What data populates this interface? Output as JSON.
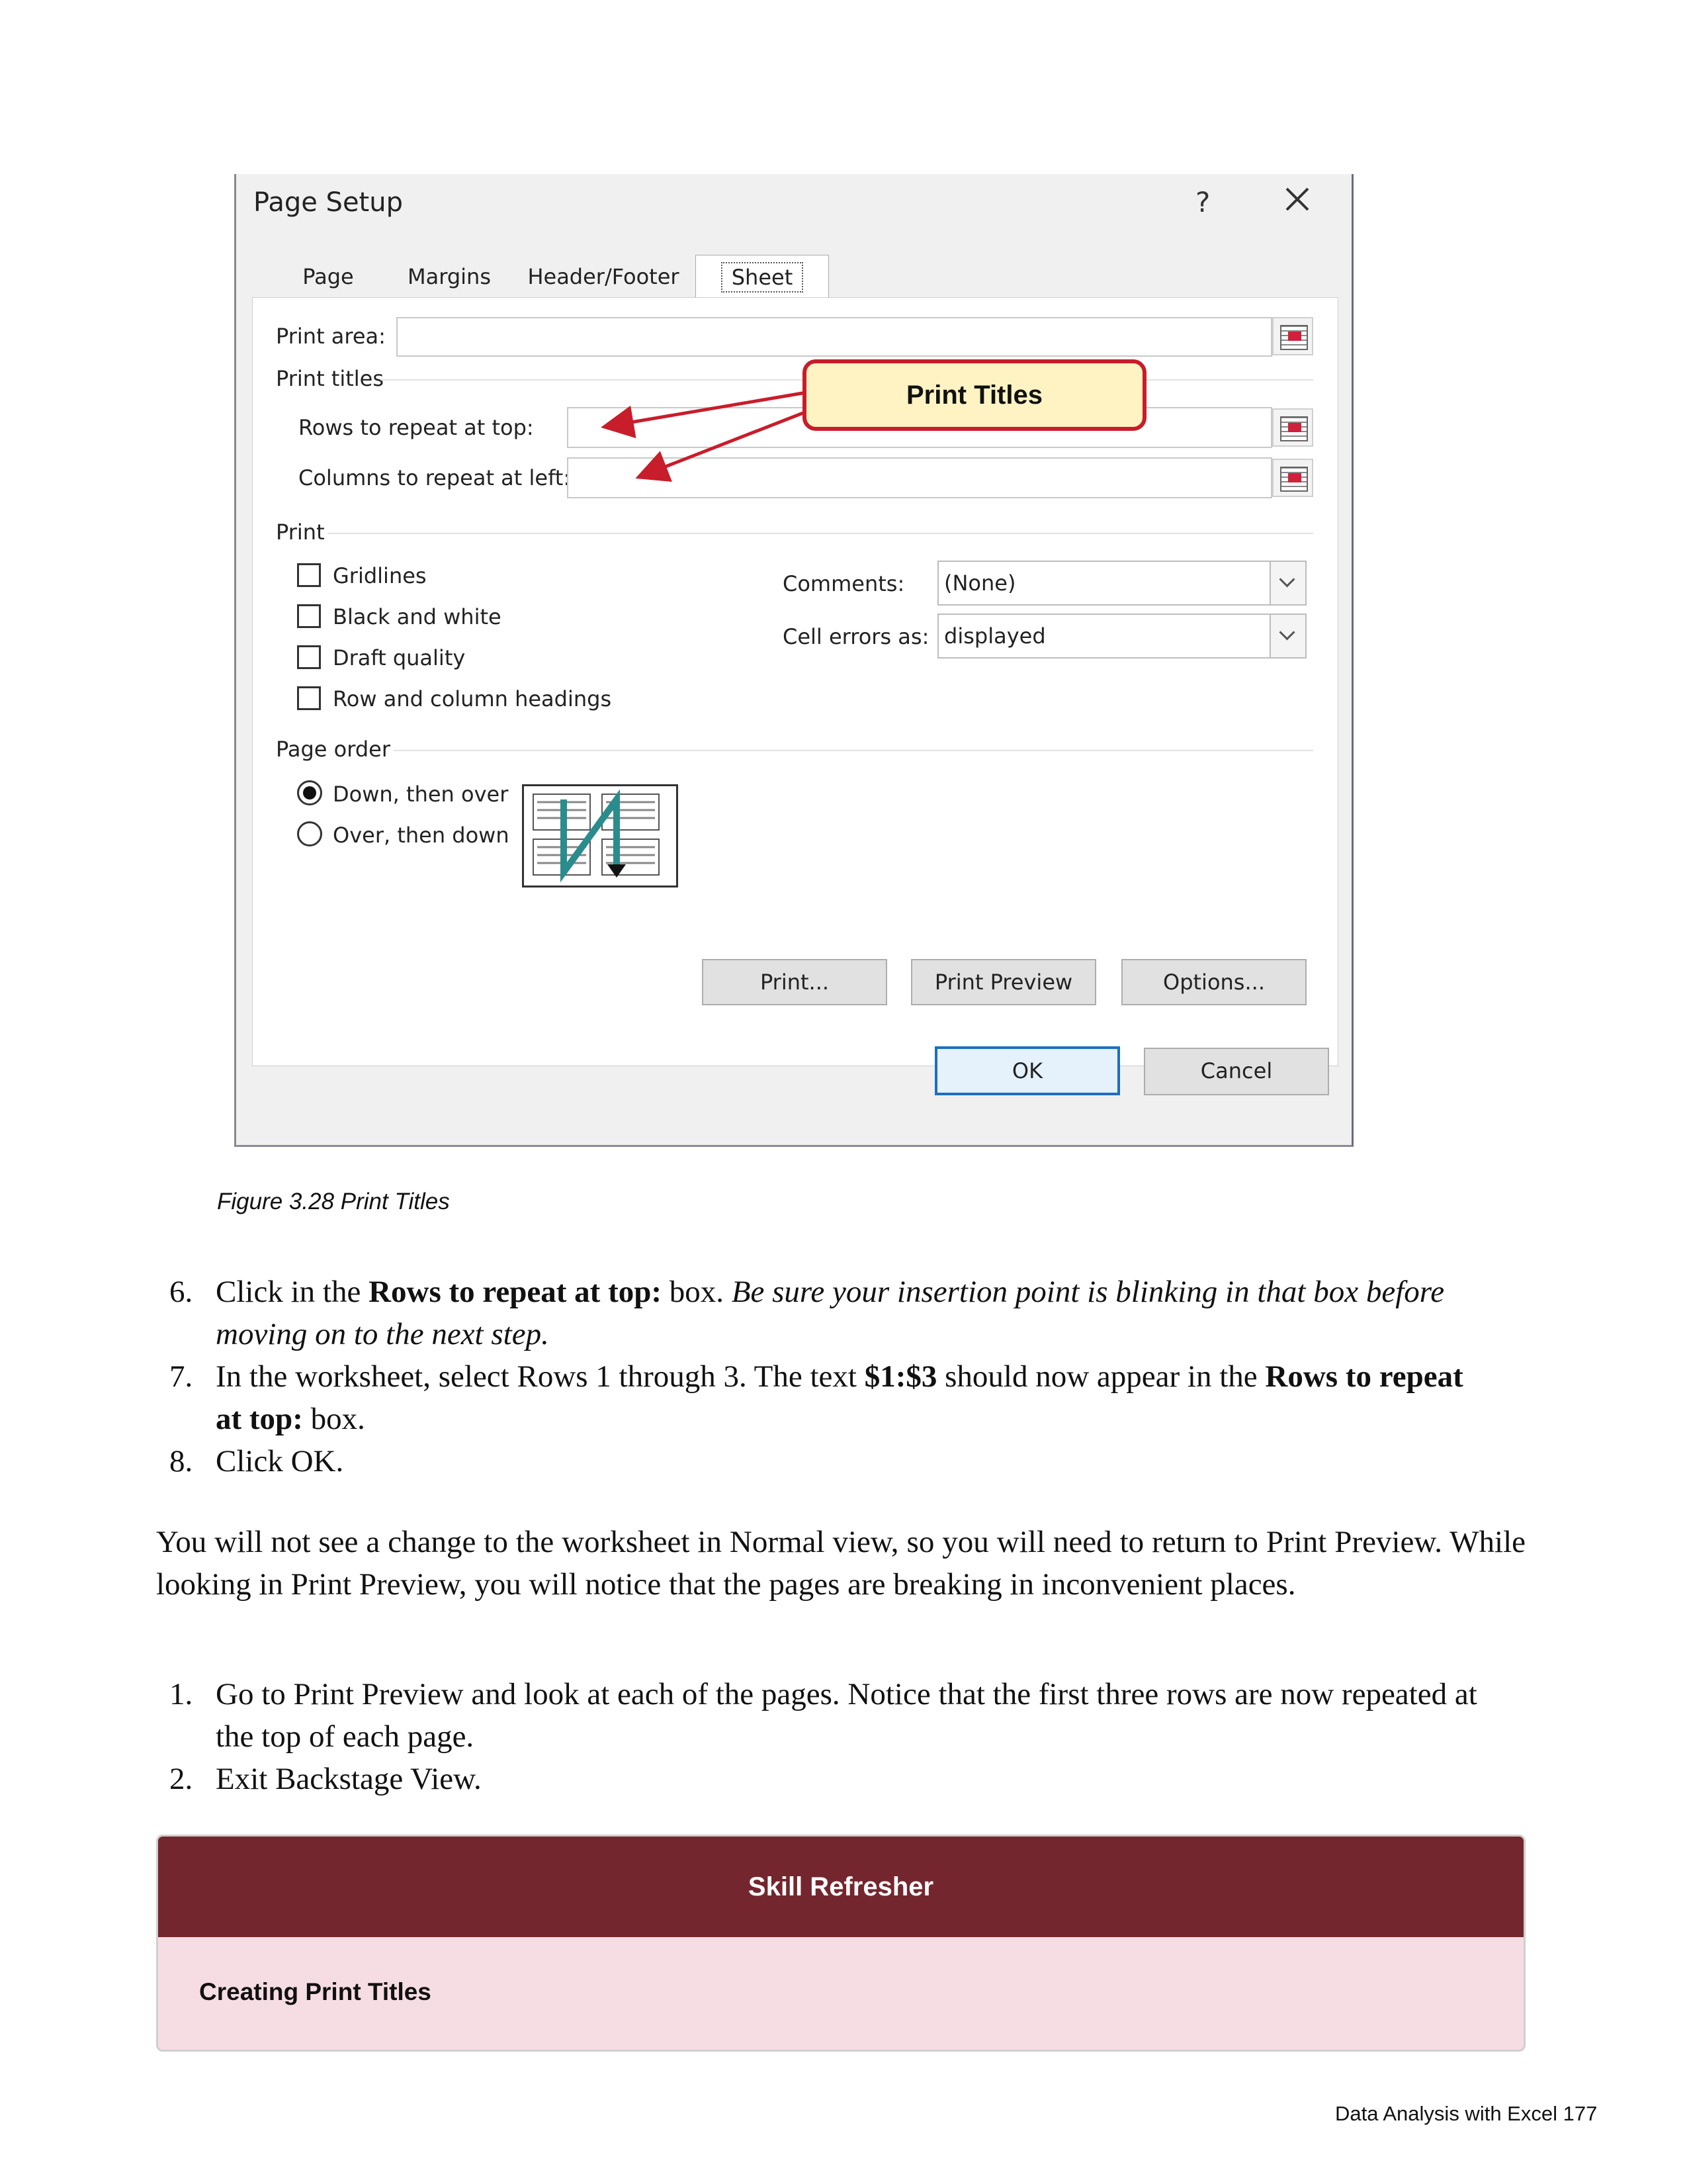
{
  "dialog": {
    "title": "Page Setup",
    "help_glyph": "?",
    "tabs": [
      "Page",
      "Margins",
      "Header/Footer",
      "Sheet"
    ],
    "print_area_label": "Print area:",
    "print_titles_label": "Print titles",
    "rows_label": "Rows to repeat at top:",
    "cols_label": "Columns to repeat at left:",
    "print_group_label": "Print",
    "checkboxes": [
      "Gridlines",
      "Black and white",
      "Draft quality",
      "Row and column headings"
    ],
    "comments_label": "Comments:",
    "comments_value": "(None)",
    "errors_label": "Cell errors as:",
    "errors_value": "displayed",
    "page_order_label": "Page order",
    "radio_down": "Down, then over",
    "radio_over": "Over, then down",
    "print_btn": "Print...",
    "preview_btn": "Print Preview",
    "options_btn": "Options...",
    "ok_btn": "OK",
    "cancel_btn": "Cancel",
    "callout": "Print Titles"
  },
  "caption": "Figure 3.28 Print Titles",
  "steps_a": [
    {
      "num": "6.",
      "pre": "Click in the ",
      "bold": "Rows to repeat at top:",
      "post": " box. ",
      "italic": "Be sure your insertion point is blinking in that box before moving on to the next step."
    },
    {
      "num": "7.",
      "pre": "In the worksheet, select Rows 1 through 3. The text ",
      "bold": "$1:$3",
      "post": " should now appear in the ",
      "bold2": "Rows to repeat at top:",
      "post2": " box."
    },
    {
      "num": "8.",
      "text": "Click OK."
    }
  ],
  "paragraph": "You will not see a change to the worksheet in Normal view, so you will need to return to Print Preview. While looking in Print Preview, you will notice that the pages are breaking in inconvenient places.",
  "steps_b": [
    {
      "num": "1.",
      "text": "Go to Print Preview and look at each of the pages. Notice that the first three rows are now repeated at the top of each page."
    },
    {
      "num": "2.",
      "text": "Exit Backstage View."
    }
  ],
  "skill_box": {
    "header": "Skill Refresher",
    "item": "Creating Print Titles"
  },
  "footer": "Data Analysis with Excel 177"
}
